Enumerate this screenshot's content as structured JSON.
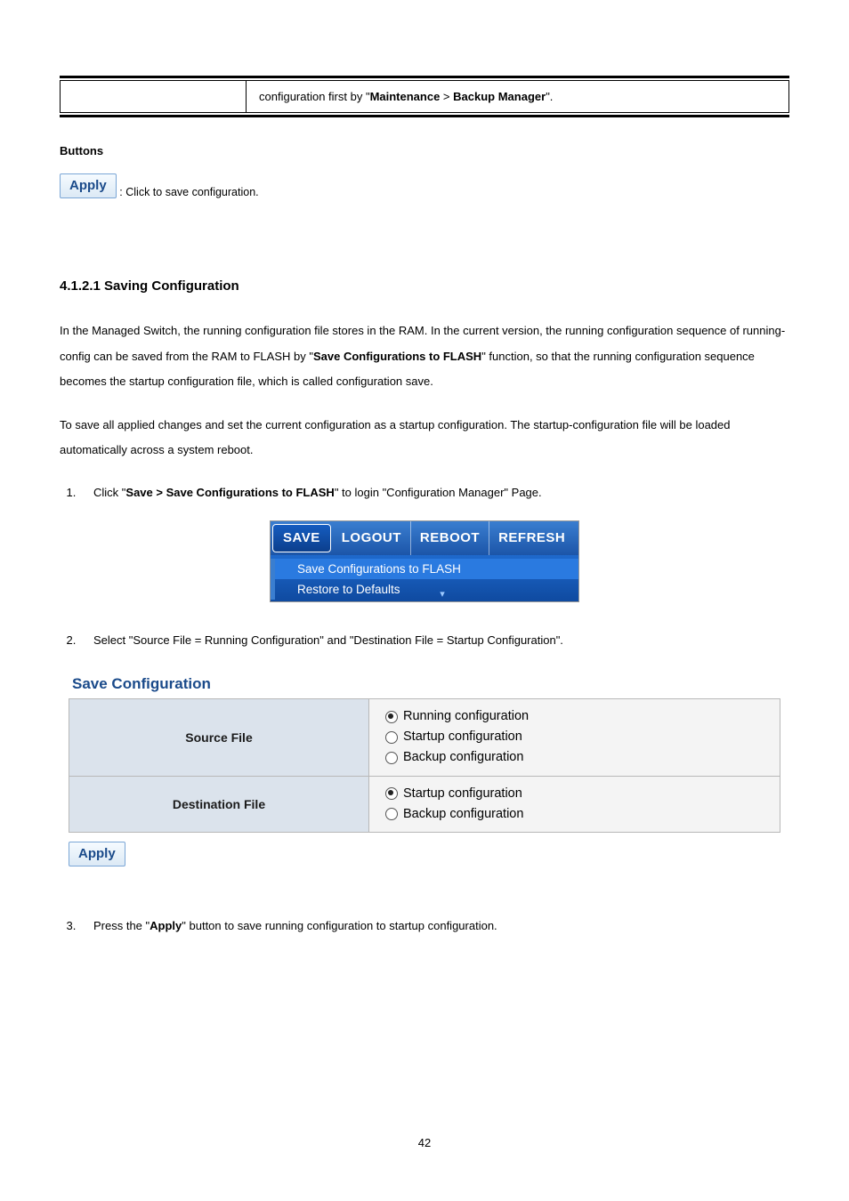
{
  "infobox": {
    "text_prefix": "configuration first by \"",
    "maintenance": "Maintenance",
    "sep": " > ",
    "backup_manager": "Backup Manager",
    "text_suffix": "\"."
  },
  "buttons_heading": "Buttons",
  "apply_label": "Apply",
  "apply_caption": ": Click to save configuration.",
  "subsection_heading": "4.1.2.1 Saving Configuration",
  "para1": {
    "t1": "In the Managed Switch, the running configuration file stores in the RAM. In the current version, the running configuration sequence of running-config can be saved from the RAM to FLASH by \"",
    "bold": "Save Configurations to FLASH",
    "t2": "\" function, so that the running configuration sequence becomes the startup configuration file, which is called configuration save."
  },
  "para2": "To save all applied changes and set the current configuration as a startup configuration. The startup-configuration file will be loaded automatically across a system reboot.",
  "step1": {
    "t1": "Click \"",
    "bold": "Save > Save Configurations to FLASH",
    "t2": "\" to login \"Configuration Manager\" Page."
  },
  "toolbar": {
    "tabs": [
      "SAVE",
      "LOGOUT",
      "REBOOT",
      "REFRESH"
    ],
    "menu": [
      "Save Configurations to FLASH",
      "Restore to Defaults"
    ]
  },
  "step2": "Select \"Source File = Running Configuration\" and \"Destination File = Startup Configuration\".",
  "panel": {
    "title": "Save Configuration",
    "row1_label": "Source File",
    "row1_opts": [
      "Running configuration",
      "Startup configuration",
      "Backup configuration"
    ],
    "row1_selected": 0,
    "row2_label": "Destination File",
    "row2_opts": [
      "Startup configuration",
      "Backup configuration"
    ],
    "row2_selected": 0,
    "apply": "Apply"
  },
  "step3": {
    "t1": "Press the \"",
    "bold": "Apply",
    "t2": "\" button to save running configuration to startup configuration."
  },
  "pagenum": "42"
}
